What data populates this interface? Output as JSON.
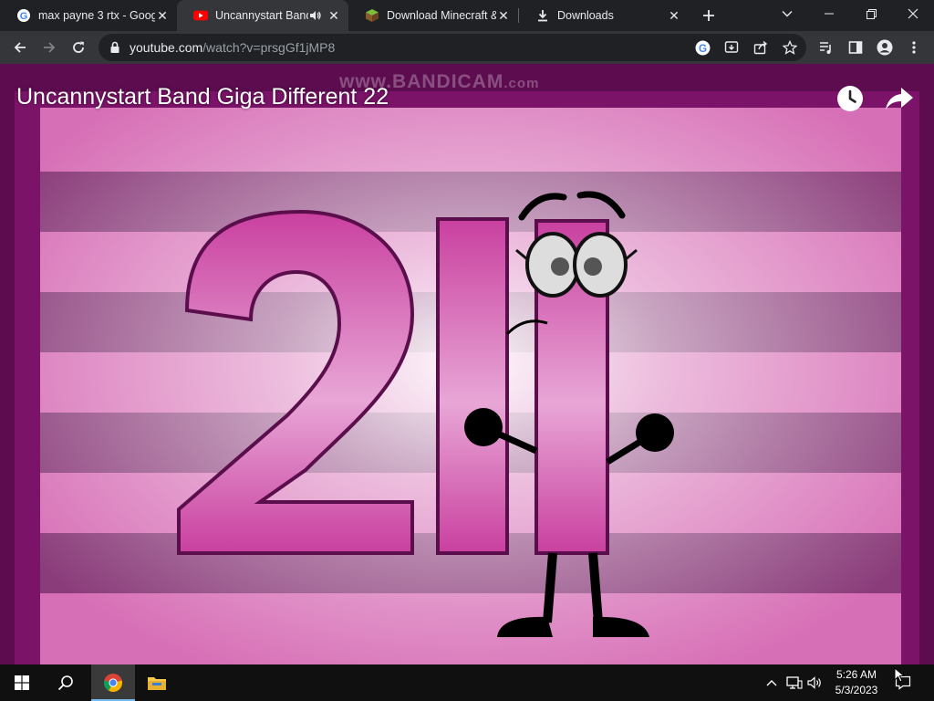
{
  "browser": {
    "tabs": [
      {
        "title": "max payne 3 rtx - Goog",
        "favicon": "google-icon",
        "active": false
      },
      {
        "title": "Uncannystart Band",
        "favicon": "youtube-icon",
        "active": true,
        "audio": "speaker-icon"
      },
      {
        "title": "Download Minecraft &",
        "favicon": "minecraft-block-icon",
        "active": false
      },
      {
        "title": "Downloads",
        "favicon": "download-icon",
        "active": false
      }
    ],
    "url_host": "youtube.com",
    "url_path": "/watch?v=prsgGf1jMP8"
  },
  "video": {
    "title": "Uncannystart Band Giga Different 22",
    "watermark_main": "www.BANDICAM",
    "watermark_suffix": ".com",
    "buttons": [
      "watch-later-icon",
      "share-icon"
    ]
  },
  "taskbar": {
    "time": "5:26 AM",
    "date": "5/3/2023"
  },
  "colors": {
    "tab_strip": "#202124",
    "toolbar": "#35363a",
    "youtube_red": "#ff0000",
    "magenta": "#c8399f",
    "taskbar": "#101010"
  }
}
